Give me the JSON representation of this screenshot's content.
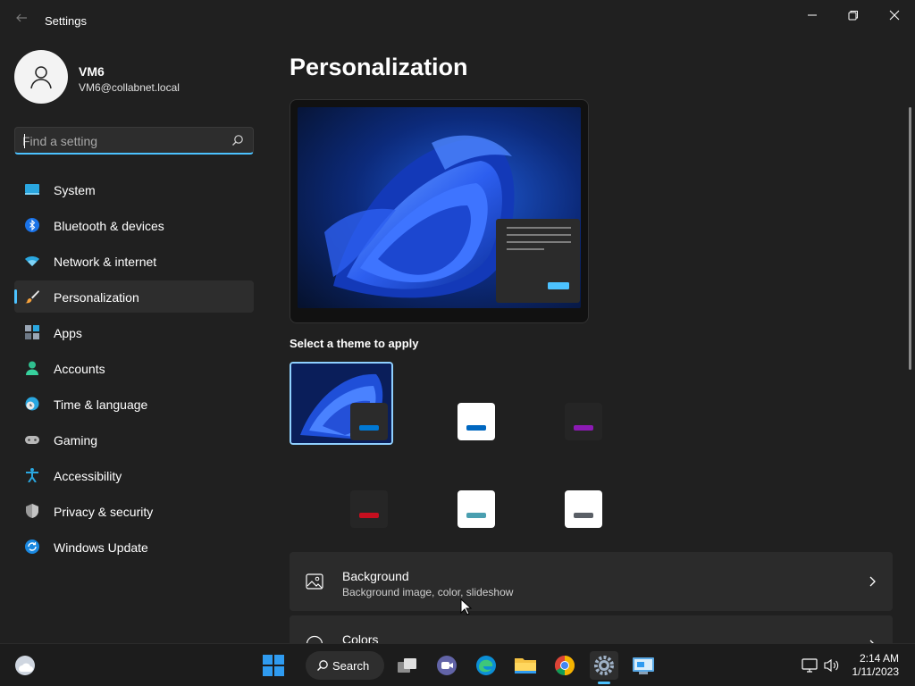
{
  "window": {
    "title": "Settings",
    "back_icon": "back-arrow-icon",
    "minimize_icon": "minimize-icon",
    "restore_icon": "restore-icon",
    "close_icon": "close-icon"
  },
  "profile": {
    "name": "VM6",
    "email": "VM6@collabnet.local",
    "avatar_icon": "person-icon"
  },
  "search": {
    "placeholder": "Find a setting",
    "value": "",
    "icon": "search-icon"
  },
  "sidebar": {
    "items": [
      {
        "label": "System",
        "icon": "monitor-icon",
        "active": false
      },
      {
        "label": "Bluetooth & devices",
        "icon": "bluetooth-icon",
        "active": false
      },
      {
        "label": "Network & internet",
        "icon": "wifi-icon",
        "active": false
      },
      {
        "label": "Personalization",
        "icon": "paintbrush-icon",
        "active": true
      },
      {
        "label": "Apps",
        "icon": "apps-icon",
        "active": false
      },
      {
        "label": "Accounts",
        "icon": "person-icon",
        "active": false
      },
      {
        "label": "Time & language",
        "icon": "clock-globe-icon",
        "active": false
      },
      {
        "label": "Gaming",
        "icon": "gamepad-icon",
        "active": false
      },
      {
        "label": "Accessibility",
        "icon": "accessibility-icon",
        "active": false
      },
      {
        "label": "Privacy & security",
        "icon": "shield-icon",
        "active": false
      },
      {
        "label": "Windows Update",
        "icon": "sync-icon",
        "active": false
      }
    ]
  },
  "main": {
    "title": "Personalization",
    "theme_section_label": "Select a theme to apply",
    "themes": [
      {
        "name": "windows-dark",
        "selected": true,
        "accent": "#0078d4"
      },
      {
        "name": "windows-light",
        "selected": false,
        "accent": "#0067c0"
      },
      {
        "name": "glow",
        "selected": false,
        "accent": "#8c1ab4"
      },
      {
        "name": "captured-motion",
        "selected": false,
        "accent": "#c50f1f"
      },
      {
        "name": "sunrise",
        "selected": false,
        "accent": "#4a9fb0"
      },
      {
        "name": "flow",
        "selected": false,
        "accent": "#5a5f66"
      }
    ],
    "cards": [
      {
        "title": "Background",
        "subtitle": "Background image, color, slideshow",
        "icon": "image-icon"
      },
      {
        "title": "Colors",
        "subtitle": "",
        "icon": "palette-icon"
      }
    ]
  },
  "taskbar": {
    "search_label": "Search",
    "icons": [
      "weather-icon",
      "start-icon",
      "search-icon",
      "task-view-icon",
      "teams-chat-icon",
      "edge-icon",
      "file-explorer-icon",
      "chrome-icon",
      "settings-icon",
      "remote-desktop-icon"
    ],
    "tray_icons": [
      "network-icon",
      "volume-icon"
    ],
    "time": "2:14 AM",
    "date": "1/11/2023"
  },
  "colors": {
    "accent": "#4cc2ff",
    "background": "#202020",
    "card": "#2b2b2b"
  }
}
